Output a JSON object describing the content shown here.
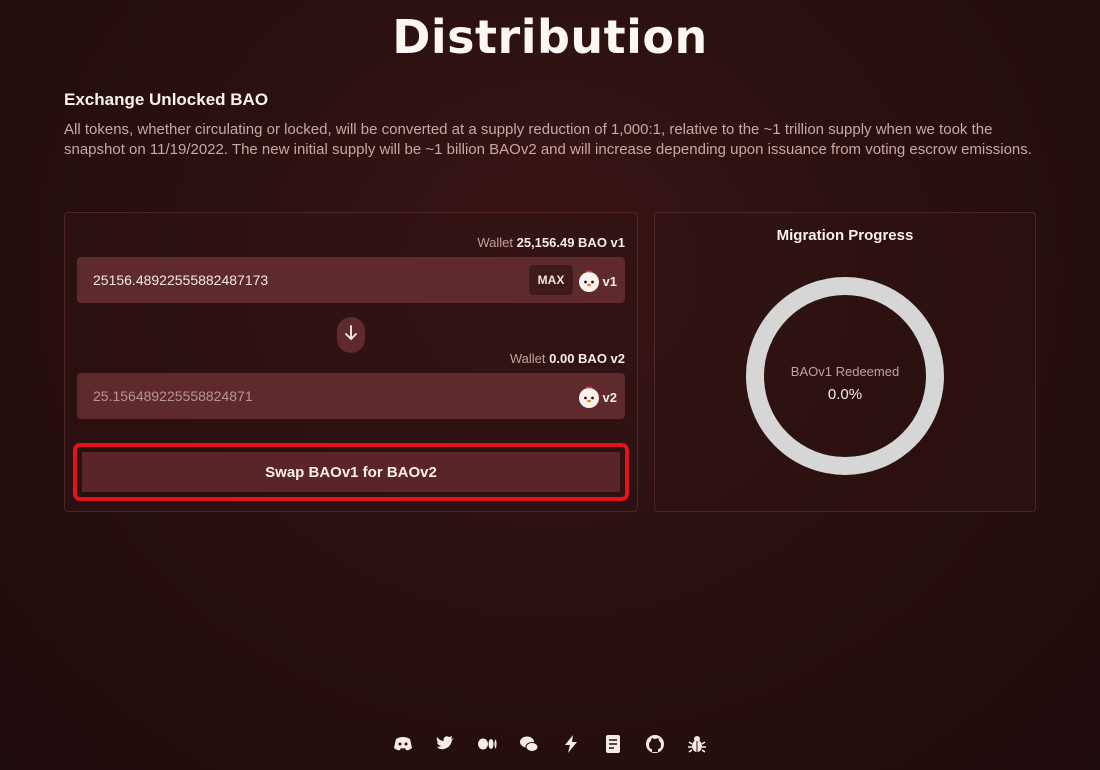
{
  "page": {
    "title": "Distribution"
  },
  "section": {
    "heading": "Exchange Unlocked BAO",
    "description": "All tokens, whether circulating or locked, will be converted at a supply reduction of 1,000:1, relative to the ~1 trillion supply when we took the snapshot on 11/19/2022. The new initial supply will be ~1 billion BAOv2 and will increase depending upon issuance from voting escrow emissions."
  },
  "swap": {
    "from": {
      "wallet_label": "Wallet",
      "wallet_amount": "25,156.49 BAO v1",
      "input_value": "25156.48922555882487173",
      "max_label": "MAX",
      "token_version": "v1"
    },
    "to": {
      "wallet_label": "Wallet",
      "wallet_amount": "0.00 BAO v2",
      "output_value": "25.15648922555882487​1",
      "token_version": "v2"
    },
    "swap_button_label": "Swap BAOv1 for BAOv2"
  },
  "migration": {
    "title": "Migration Progress",
    "ring_label": "BAOv1 Redeemed",
    "ring_value": "0.0%",
    "progress_fraction": 0.0
  },
  "footer": {
    "icons": [
      "discord-icon",
      "twitter-icon",
      "medium-icon",
      "forum-icon",
      "snapshot-icon",
      "docs-icon",
      "github-icon",
      "bug-bounty-icon"
    ]
  },
  "colors": {
    "accent_red": "#e0141a",
    "field_bg": "#5e2a2b",
    "ring_track": "#d6d6d6"
  }
}
